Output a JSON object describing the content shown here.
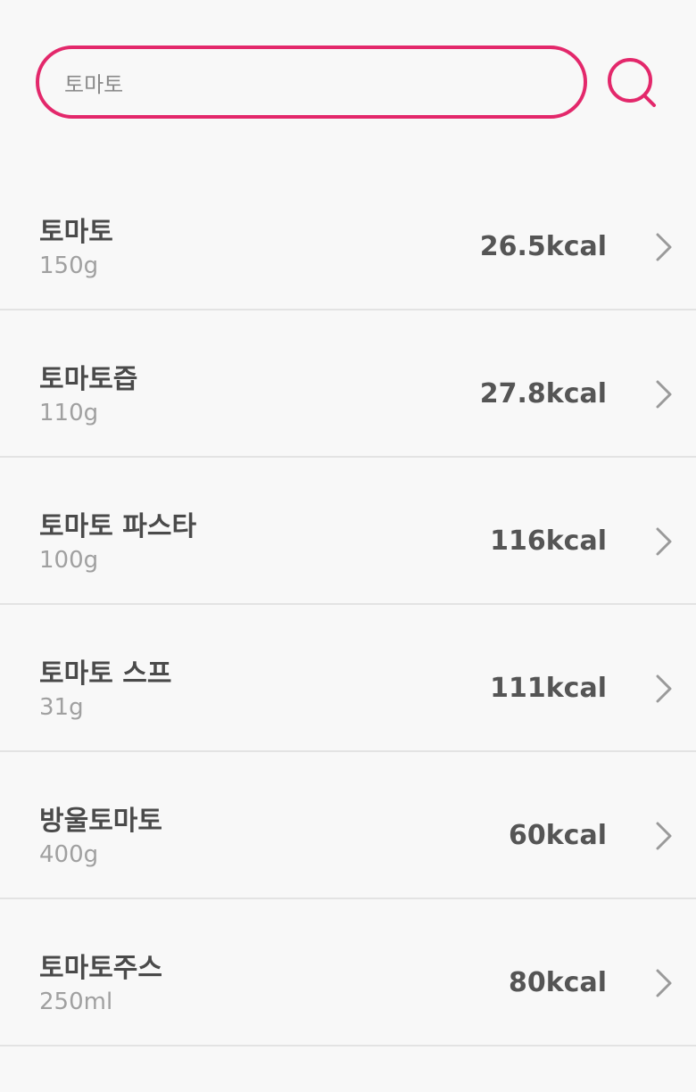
{
  "search": {
    "value": "토마토",
    "accent_color": "#e3286b",
    "button_icon": "search-icon"
  },
  "results": [
    {
      "name": "토마토",
      "amount": "150g",
      "kcal": "26.5kcal"
    },
    {
      "name": "토마토즙",
      "amount": "110g",
      "kcal": "27.8kcal"
    },
    {
      "name": "토마토 파스타",
      "amount": "100g",
      "kcal": "116kcal"
    },
    {
      "name": "토마토 스프",
      "amount": "31g",
      "kcal": "111kcal"
    },
    {
      "name": "방울토마토",
      "amount": "400g",
      "kcal": "60kcal"
    },
    {
      "name": "토마토주스",
      "amount": "250ml",
      "kcal": "80kcal"
    }
  ],
  "row_icon": "chevron-right-icon"
}
